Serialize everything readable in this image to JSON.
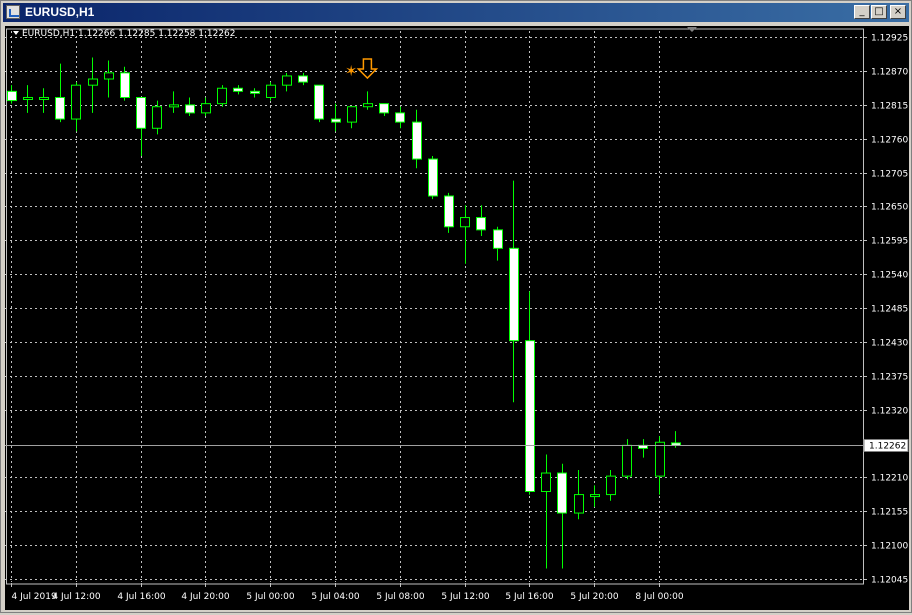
{
  "window": {
    "title": "EURUSD,H1",
    "buttons": [
      "minimize",
      "maximize",
      "close"
    ]
  },
  "chart_header": {
    "symbol": "EURUSD,H1",
    "open": "1.12266",
    "high": "1.12285",
    "low": "1.12258",
    "close": "1.12262"
  },
  "colors": {
    "background": "#000000",
    "grid": "#c0c0c0",
    "bull": "#000000",
    "bear": "#ffffff",
    "wick": "#00ff00",
    "axis_text": "#ffffff",
    "marker": "#ff9900"
  },
  "price_axis": {
    "labels": [
      "1.12925",
      "1.12870",
      "1.12815",
      "1.12760",
      "1.12705",
      "1.12650",
      "1.12595",
      "1.12540",
      "1.12485",
      "1.12430",
      "1.12375",
      "1.12320",
      "1.12210",
      "1.12155",
      "1.12100",
      "1.12045"
    ],
    "current_price": "1.12262"
  },
  "time_axis": {
    "labels": [
      "4 Jul 2019",
      "4 Jul 12:00",
      "4 Jul 16:00",
      "4 Jul 20:00",
      "5 Jul 00:00",
      "5 Jul 04:00",
      "5 Jul 08:00",
      "5 Jul 12:00",
      "5 Jul 16:00",
      "5 Jul 20:00",
      "8 Jul 00:00"
    ]
  },
  "chart_data": {
    "type": "candlestick",
    "symbol": "EURUSD",
    "timeframe": "H1",
    "ylim": [
      1.1204,
      1.12935
    ],
    "candles": [
      {
        "o": 1.12837,
        "h": 1.12847,
        "l": 1.12817,
        "c": 1.12822
      },
      {
        "o": 1.12827,
        "h": 1.12847,
        "l": 1.12802,
        "c": 1.12827
      },
      {
        "o": 1.12827,
        "h": 1.12842,
        "l": 1.12802,
        "c": 1.12827
      },
      {
        "o": 1.12827,
        "h": 1.12882,
        "l": 1.12787,
        "c": 1.12792
      },
      {
        "o": 1.12792,
        "h": 1.12852,
        "l": 1.12772,
        "c": 1.12847
      },
      {
        "o": 1.12847,
        "h": 1.12892,
        "l": 1.12802,
        "c": 1.12857
      },
      {
        "o": 1.12857,
        "h": 1.12887,
        "l": 1.12827,
        "c": 1.12867
      },
      {
        "o": 1.12867,
        "h": 1.12877,
        "l": 1.12822,
        "c": 1.12827
      },
      {
        "o": 1.12827,
        "h": 1.12827,
        "l": 1.12732,
        "c": 1.12777
      },
      {
        "o": 1.12777,
        "h": 1.12822,
        "l": 1.12767,
        "c": 1.12812
      },
      {
        "o": 1.12812,
        "h": 1.12837,
        "l": 1.12802,
        "c": 1.12815
      },
      {
        "o": 1.12815,
        "h": 1.12827,
        "l": 1.12797,
        "c": 1.12802
      },
      {
        "o": 1.12802,
        "h": 1.12827,
        "l": 1.12797,
        "c": 1.12817
      },
      {
        "o": 1.12817,
        "h": 1.12847,
        "l": 1.12812,
        "c": 1.12842
      },
      {
        "o": 1.12842,
        "h": 1.12847,
        "l": 1.12832,
        "c": 1.12837
      },
      {
        "o": 1.12837,
        "h": 1.12842,
        "l": 1.12827,
        "c": 1.12835
      },
      {
        "o": 1.12827,
        "h": 1.12852,
        "l": 1.12822,
        "c": 1.12847
      },
      {
        "o": 1.12847,
        "h": 1.12867,
        "l": 1.12837,
        "c": 1.12862
      },
      {
        "o": 1.12862,
        "h": 1.12867,
        "l": 1.12847,
        "c": 1.12852
      },
      {
        "o": 1.12847,
        "h": 1.12847,
        "l": 1.12787,
        "c": 1.12792
      },
      {
        "o": 1.12792,
        "h": 1.12817,
        "l": 1.12772,
        "c": 1.12787
      },
      {
        "o": 1.12787,
        "h": 1.12812,
        "l": 1.12777,
        "c": 1.12812
      },
      {
        "o": 1.12812,
        "h": 1.12837,
        "l": 1.12807,
        "c": 1.12817
      },
      {
        "o": 1.12817,
        "h": 1.12817,
        "l": 1.12797,
        "c": 1.12802
      },
      {
        "o": 1.12802,
        "h": 1.12812,
        "l": 1.12777,
        "c": 1.12787
      },
      {
        "o": 1.12787,
        "h": 1.12807,
        "l": 1.12712,
        "c": 1.12727
      },
      {
        "o": 1.12727,
        "h": 1.12732,
        "l": 1.12662,
        "c": 1.12667
      },
      {
        "o": 1.12667,
        "h": 1.12672,
        "l": 1.12607,
        "c": 1.12617
      },
      {
        "o": 1.12617,
        "h": 1.12652,
        "l": 1.12557,
        "c": 1.12632
      },
      {
        "o": 1.12632,
        "h": 1.12652,
        "l": 1.12602,
        "c": 1.12612
      },
      {
        "o": 1.12612,
        "h": 1.12617,
        "l": 1.12562,
        "c": 1.12582
      },
      {
        "o": 1.12582,
        "h": 1.12692,
        "l": 1.12332,
        "c": 1.12432
      },
      {
        "o": 1.12432,
        "h": 1.12512,
        "l": 1.12182,
        "c": 1.12187
      },
      {
        "o": 1.12187,
        "h": 1.12247,
        "l": 1.12062,
        "c": 1.12217
      },
      {
        "o": 1.12217,
        "h": 1.12232,
        "l": 1.12062,
        "c": 1.12152
      },
      {
        "o": 1.12152,
        "h": 1.12222,
        "l": 1.12142,
        "c": 1.12182
      },
      {
        "o": 1.12182,
        "h": 1.12197,
        "l": 1.12162,
        "c": 1.12182
      },
      {
        "o": 1.12182,
        "h": 1.12222,
        "l": 1.12172,
        "c": 1.12212
      },
      {
        "o": 1.12212,
        "h": 1.12272,
        "l": 1.12207,
        "c": 1.12262
      },
      {
        "o": 1.12262,
        "h": 1.12272,
        "l": 1.12242,
        "c": 1.12257
      },
      {
        "o": 1.12212,
        "h": 1.12277,
        "l": 1.12182,
        "c": 1.12267
      },
      {
        "o": 1.12266,
        "h": 1.12285,
        "l": 1.12258,
        "c": 1.12262
      }
    ],
    "markers": [
      {
        "type": "star",
        "candle_index": 21,
        "price": 1.1287
      },
      {
        "type": "down-arrow",
        "candle_index": 22,
        "price": 1.1287
      }
    ]
  }
}
